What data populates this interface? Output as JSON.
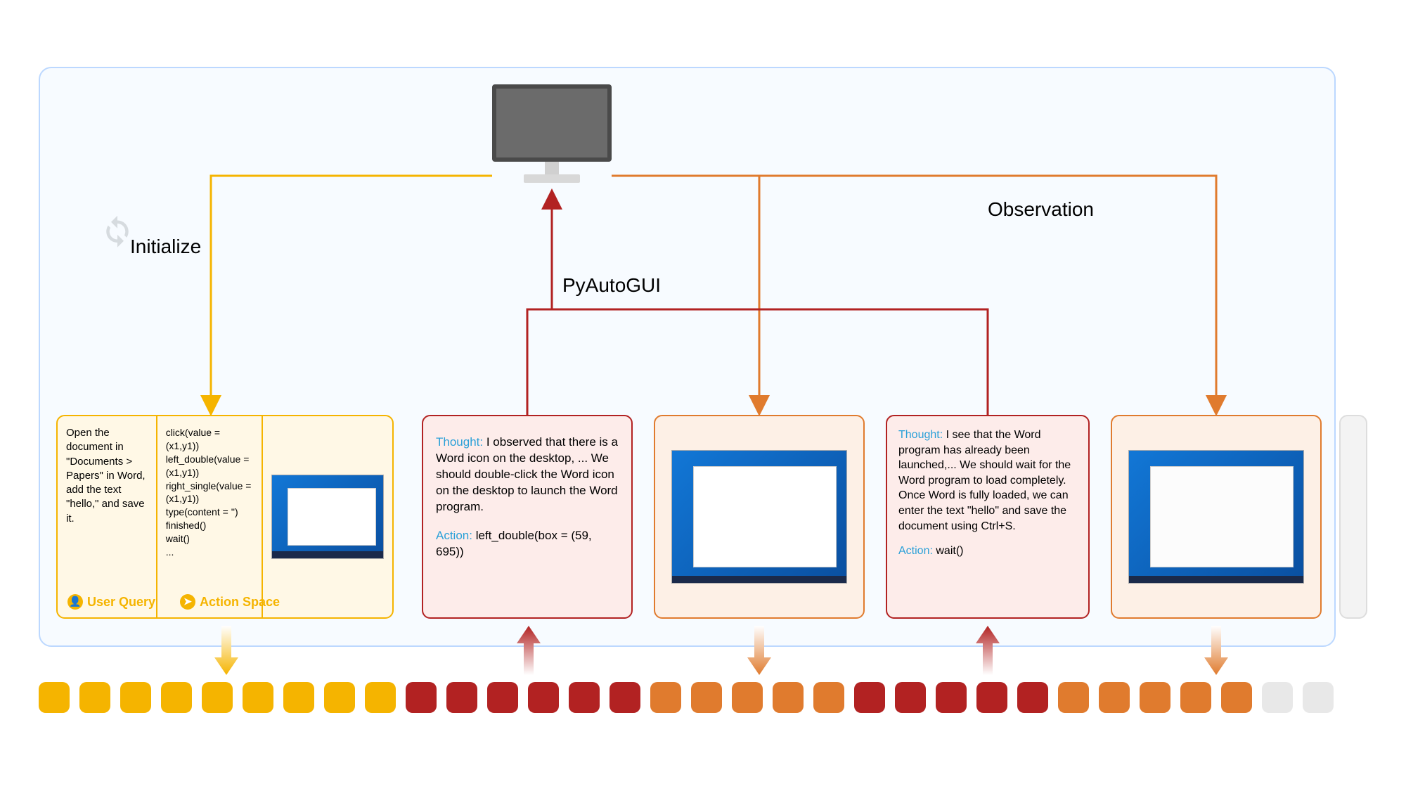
{
  "labels": {
    "initialize": "Initialize",
    "pyautogui": "PyAutoGUI",
    "observation": "Observation"
  },
  "init_card": {
    "user_query": "Open the document in \"Documents > Papers\" in Word, add the text \"hello,\" and save it.",
    "action_space": [
      "click(value = (x1,y1))",
      "left_double(value = (x1,y1))",
      "right_single(value = (x1,y1))",
      "type(content = '')",
      "finished()",
      "wait()",
      "..."
    ],
    "tags": {
      "user_query": "User Query",
      "action_space": "Action Space"
    }
  },
  "thought1": {
    "thought_label": "Thought:",
    "thought": "I observed that there is a Word icon on the desktop, ... We should double-click the Word icon on the desktop to launch the Word program.",
    "action_label": "Action:",
    "action": "left_double(box = (59, 695))"
  },
  "thought2": {
    "thought_label": "Thought:",
    "thought": "I see that the Word program has already been launched,... We should wait for the Word program to load completely. Once Word is fully loaded, we can enter the text \"hello\" and save the document using Ctrl+S.",
    "action_label": "Action:",
    "action": "wait()"
  },
  "token_colors": [
    "y",
    "y",
    "y",
    "y",
    "y",
    "y",
    "y",
    "y",
    "y",
    "r",
    "r",
    "r",
    "r",
    "r",
    "r",
    "o",
    "o",
    "o",
    "o",
    "o",
    "r",
    "r",
    "r",
    "r",
    "r",
    "o",
    "o",
    "o",
    "o",
    "o",
    "g",
    "g"
  ],
  "monitor": {
    "name": "Desktop environment"
  }
}
